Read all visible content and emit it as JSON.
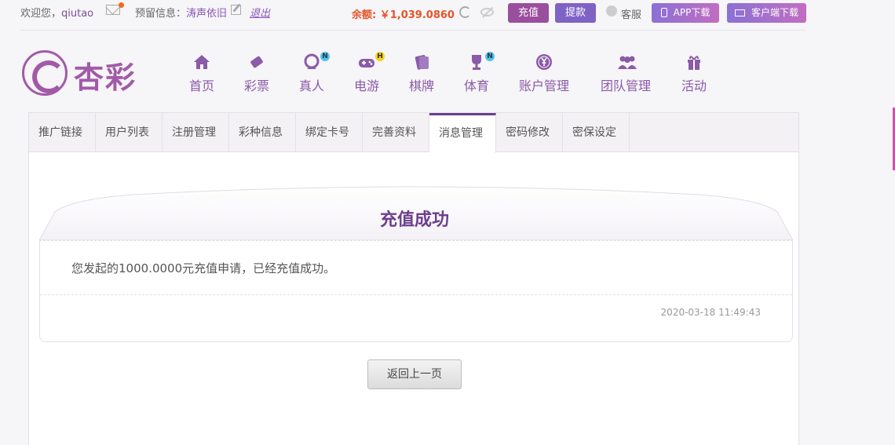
{
  "topbar": {
    "welcome": "欢迎您，",
    "username": "qiutao",
    "reserve_label": "预留信息：",
    "reserve_value": "涛声依旧",
    "logout": "退出",
    "balance": "余额: ￥1,039.0860",
    "recharge": "充值",
    "withdraw": "提款",
    "service": "客服",
    "app_download": "APP下载",
    "client_download": "客户端下载"
  },
  "logo": {
    "text": "杏彩"
  },
  "nav": [
    {
      "label": "首页",
      "icon": "home-icon"
    },
    {
      "label": "彩票",
      "icon": "ticket-icon"
    },
    {
      "label": "真人",
      "icon": "live-dealer-icon",
      "badge": "N"
    },
    {
      "label": "电游",
      "icon": "gamepad-icon",
      "badge": "H"
    },
    {
      "label": "棋牌",
      "icon": "cards-icon"
    },
    {
      "label": "体育",
      "icon": "trophy-icon",
      "badge": "N"
    },
    {
      "label": "账户管理",
      "icon": "yen-coin-icon"
    },
    {
      "label": "团队管理",
      "icon": "team-icon"
    },
    {
      "label": "活动",
      "icon": "gift-icon"
    }
  ],
  "tabs": [
    {
      "label": "推广链接"
    },
    {
      "label": "用户列表"
    },
    {
      "label": "注册管理"
    },
    {
      "label": "彩种信息"
    },
    {
      "label": "绑定卡号"
    },
    {
      "label": "完善资料"
    },
    {
      "label": "消息管理",
      "active": true
    },
    {
      "label": "密码修改"
    },
    {
      "label": "密保设定"
    }
  ],
  "message": {
    "title": "充值成功",
    "body": "您发起的1000.0000元充值申请，已经充值成功。",
    "time": "2020-03-18 11:49:43"
  },
  "back_button": "返回上一页",
  "colors": {
    "brand": "#8b5aa8",
    "accent_orange": "#e4542b",
    "title_purple": "#6c3f8c"
  }
}
